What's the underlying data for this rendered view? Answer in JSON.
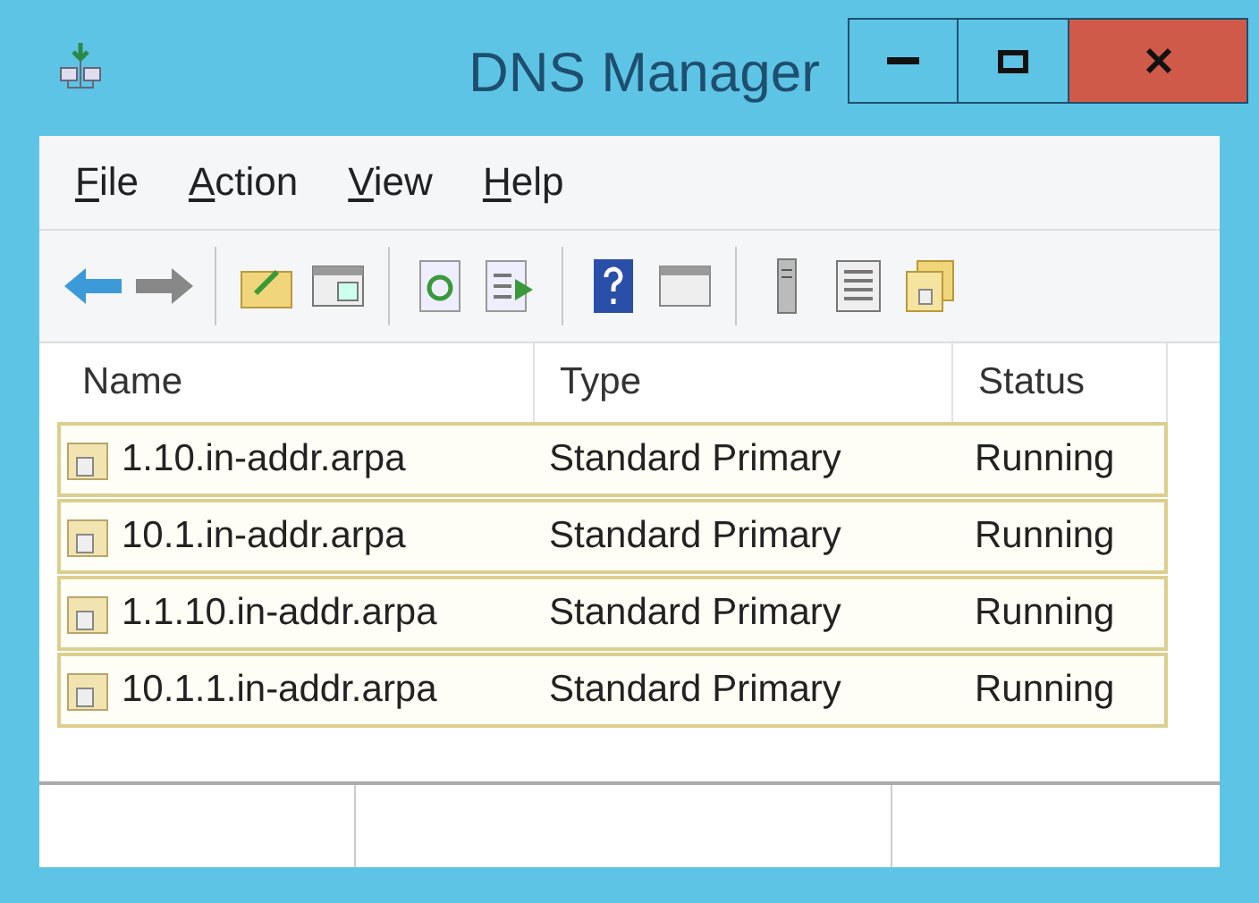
{
  "window": {
    "title": "DNS Manager"
  },
  "menu": [
    {
      "accelerator": "F",
      "rest": "ile"
    },
    {
      "accelerator": "A",
      "rest": "ction"
    },
    {
      "accelerator": "V",
      "rest": "iew"
    },
    {
      "accelerator": "H",
      "rest": "elp"
    }
  ],
  "table": {
    "columns": [
      "Name",
      "Type",
      "Status"
    ],
    "rows": [
      {
        "name": "1.10.in-addr.arpa",
        "type": "Standard Primary",
        "status": "Running",
        "selected": true
      },
      {
        "name": "10.1.in-addr.arpa",
        "type": "Standard Primary",
        "status": "Running",
        "selected": true
      },
      {
        "name": "1.1.10.in-addr.arpa",
        "type": "Standard Primary",
        "status": "Running",
        "selected": true
      },
      {
        "name": "10.1.1.in-addr.arpa",
        "type": "Standard Primary",
        "status": "Running",
        "selected": true
      }
    ]
  }
}
